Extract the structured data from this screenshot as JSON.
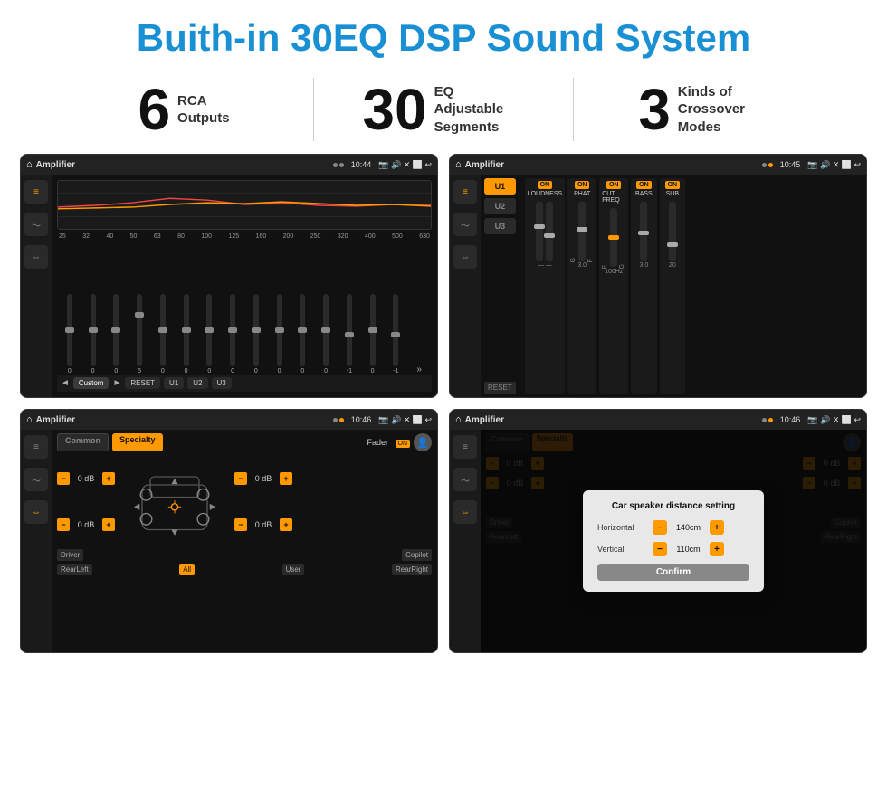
{
  "header": {
    "title": "Buith-in 30EQ DSP Sound System"
  },
  "stats": [
    {
      "number": "6",
      "label": "RCA\nOutputs"
    },
    {
      "number": "30",
      "label": "EQ Adjustable\nSegments"
    },
    {
      "number": "3",
      "label": "Kinds of\nCrossover Modes"
    }
  ],
  "screens": [
    {
      "id": "screen1",
      "app_name": "Amplifier",
      "time": "10:44",
      "eq_freqs": [
        "25",
        "32",
        "40",
        "50",
        "63",
        "80",
        "100",
        "125",
        "160",
        "200",
        "250",
        "320",
        "400",
        "500",
        "630"
      ],
      "eq_values": [
        "0",
        "0",
        "0",
        "5",
        "0",
        "0",
        "0",
        "0",
        "0",
        "0",
        "0",
        "0",
        "-1",
        "0",
        "-1"
      ],
      "bottom_buttons": [
        "◄",
        "Custom",
        "►",
        "RESET",
        "U1",
        "U2",
        "U3"
      ]
    },
    {
      "id": "screen2",
      "app_name": "Amplifier",
      "time": "10:45",
      "u_buttons": [
        "U1",
        "U2",
        "U3"
      ],
      "panels": [
        {
          "on": true,
          "title": "LOUDNESS"
        },
        {
          "on": true,
          "title": "PHAT"
        },
        {
          "on": true,
          "title": "CUT FREQ"
        },
        {
          "on": true,
          "title": "BASS"
        },
        {
          "on": true,
          "title": "SUB"
        }
      ]
    },
    {
      "id": "screen3",
      "app_name": "Amplifier",
      "time": "10:46",
      "tabs": [
        "Common",
        "Specialty"
      ],
      "active_tab": "Specialty",
      "fader_label": "Fader",
      "channels": [
        {
          "value": "0 dB"
        },
        {
          "value": "0 dB"
        },
        {
          "value": "0 dB"
        },
        {
          "value": "0 dB"
        }
      ],
      "bottom_labels": [
        "Driver",
        "",
        "Copilot",
        "RearLeft",
        "All",
        "User",
        "RearRight"
      ]
    },
    {
      "id": "screen4",
      "app_name": "Amplifier",
      "time": "10:46",
      "dialog": {
        "title": "Car speaker distance setting",
        "horizontal_label": "Horizontal",
        "horizontal_value": "140cm",
        "vertical_label": "Vertical",
        "vertical_value": "110cm",
        "confirm_label": "Confirm"
      }
    }
  ],
  "colors": {
    "accent": "#f90",
    "blue": "#1a90d4",
    "dark_bg": "#1a1a1a",
    "medium_bg": "#2a2a2a"
  }
}
